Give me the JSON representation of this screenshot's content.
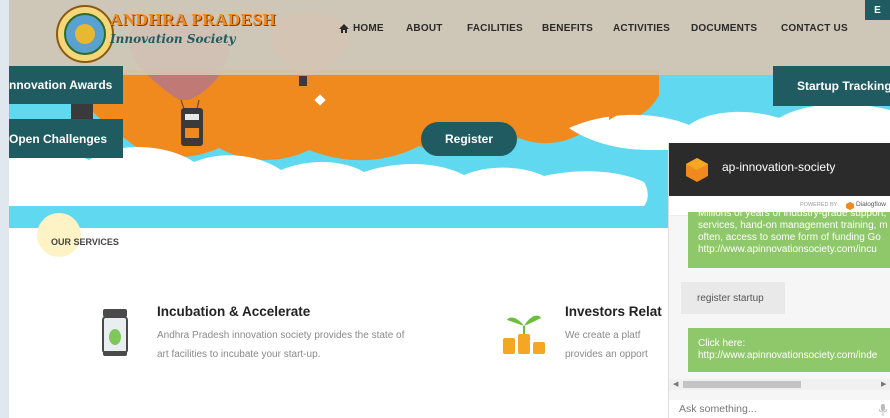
{
  "brand": {
    "line1": "ANDHRA PRADESH",
    "line2": "Innovation Society"
  },
  "nav": [
    {
      "label": "HOME",
      "icon": "home-icon"
    },
    {
      "label": "ABOUT"
    },
    {
      "label": "FACILITIES"
    },
    {
      "label": "BENEFITS"
    },
    {
      "label": "ACTIVITIES"
    },
    {
      "label": "DOCUMENTS"
    },
    {
      "label": "CONTACT US"
    }
  ],
  "corner_badge": "E",
  "hero": {
    "left_buttons": [
      "nnovation Awards",
      "Open Challenges"
    ],
    "right_button": "Startup Tracking",
    "register": "Register"
  },
  "services": {
    "title": "OUR SERVICES",
    "items": [
      {
        "title": "Incubation & Accelerate",
        "desc": [
          "Andhra Pradesh innovation society provides the state of",
          "art facilities to incubate your start-up."
        ],
        "icon": "incubator-jar-icon"
      },
      {
        "title": "Investors Relat",
        "desc": [
          "We  create  a  platf",
          "provides an opport"
        ],
        "icon": "money-plant-icon"
      }
    ]
  },
  "chat": {
    "title": "ap-innovation-society",
    "powered_by": "POWERED BY",
    "powered_brand": "Dialogflow",
    "messages": [
      {
        "from": "bot",
        "lines": [
          "Millions of years of industry-grade support,",
          "services, hand-on management training, m",
          "often, access to some form of funding Go",
          "http://www.apinnovationsociety.com/incu"
        ]
      },
      {
        "from": "user",
        "lines": [
          "register startup"
        ]
      },
      {
        "from": "bot",
        "lines": [
          "Click here:",
          "http://www.apinnovationsociety.com/inde"
        ]
      }
    ],
    "input_placeholder": "Ask something..."
  },
  "colors": {
    "teal": "#1f5b61",
    "sky": "#5fd8f0",
    "orange": "#f08a1e",
    "chat_green": "#8fc86a",
    "chat_dark": "#2b2b2b"
  }
}
